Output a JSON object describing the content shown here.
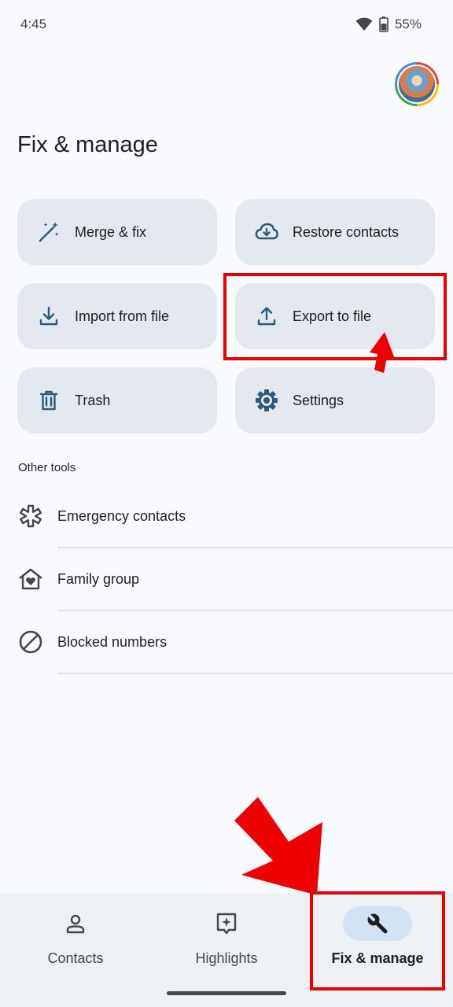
{
  "status_bar": {
    "time": "4:45",
    "battery": "55%",
    "icons": [
      "wifi-icon",
      "battery-icon"
    ]
  },
  "header": {
    "title": "Fix & manage",
    "avatar_icon": "account-avatar-icon"
  },
  "tiles": [
    {
      "label": "Merge & fix",
      "icon": "magic-wand-icon"
    },
    {
      "label": "Restore contacts",
      "icon": "cloud-download-icon"
    },
    {
      "label": "Import from file",
      "icon": "download-icon"
    },
    {
      "label": "Export to file",
      "icon": "upload-icon"
    },
    {
      "label": "Trash",
      "icon": "trash-icon"
    },
    {
      "label": "Settings",
      "icon": "gear-icon"
    }
  ],
  "other_tools": {
    "heading": "Other tools",
    "items": [
      {
        "label": "Emergency contacts",
        "icon": "medical-asterisk-icon"
      },
      {
        "label": "Family group",
        "icon": "family-home-icon"
      },
      {
        "label": "Blocked numbers",
        "icon": "block-icon"
      }
    ]
  },
  "bottom_nav": {
    "items": [
      {
        "label": "Contacts",
        "icon": "person-icon",
        "active": false
      },
      {
        "label": "Highlights",
        "icon": "sparkle-icon",
        "active": false
      },
      {
        "label": "Fix & manage",
        "icon": "wrench-icon",
        "active": true
      }
    ]
  },
  "colors": {
    "accent": "#d3e3f2",
    "tile": "#e3e9ee",
    "icon": "#2c5a78",
    "annotation": "#ee0000"
  }
}
